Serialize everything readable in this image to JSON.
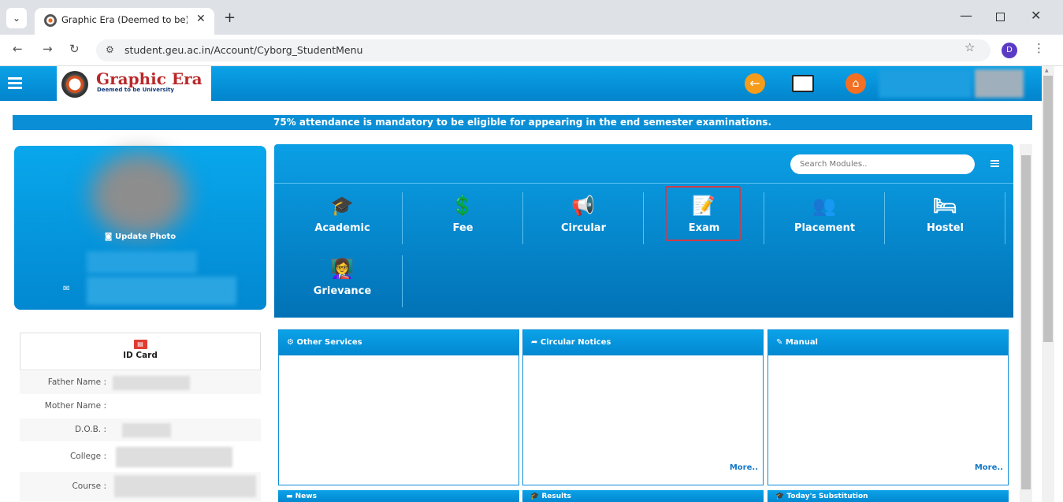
{
  "browser": {
    "tab_title": "Graphic Era (Deemed to be) Uni",
    "new_tab": "+",
    "url": "student.geu.ac.in/Account/Cyborg_StudentMenu",
    "profile_initial": "D"
  },
  "header": {
    "logo_title": "Graphic Era",
    "logo_subtitle": "Deemed to be University"
  },
  "notice": "75% attendance is mandatory to be eligible for appearing in the end semester examinations.",
  "profile": {
    "update_photo": "Update Photo"
  },
  "search": {
    "placeholder": "Search Modules.."
  },
  "modules": [
    {
      "label": "Academic",
      "icon": "graduation-icon"
    },
    {
      "label": "Fee",
      "icon": "fee-icon"
    },
    {
      "label": "Circular",
      "icon": "megaphone-icon"
    },
    {
      "label": "Exam",
      "icon": "exam-icon"
    },
    {
      "label": "Placement",
      "icon": "placement-icon"
    },
    {
      "label": "Hostel",
      "icon": "hostel-icon"
    },
    {
      "label": "Grievance",
      "icon": "grievance-icon"
    }
  ],
  "id_card": {
    "label": "ID Card"
  },
  "details": [
    {
      "label": "Father Name :"
    },
    {
      "label": "Mother Name :"
    },
    {
      "label": "D.O.B. :"
    },
    {
      "label": "College :"
    },
    {
      "label": "Course :"
    }
  ],
  "panels": [
    {
      "title": "Other Services",
      "more": ""
    },
    {
      "title": "Circular Notices",
      "more": "More.."
    },
    {
      "title": "Manual",
      "more": "More.."
    }
  ],
  "bottom_panels": [
    "News",
    "Results",
    "Today's Substitution"
  ],
  "colors": {
    "brand_blue": "#0a8fd6",
    "highlight_red": "#d03b48"
  }
}
